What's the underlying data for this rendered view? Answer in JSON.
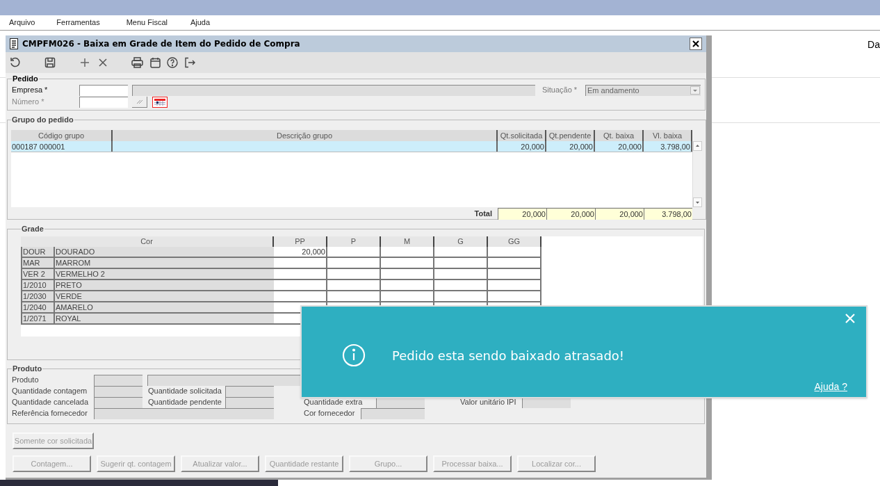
{
  "menu": [
    {
      "label": "Arquivo"
    },
    {
      "label": "Ferramentas"
    },
    {
      "label": "Menu Fiscal"
    },
    {
      "label": "Ajuda"
    }
  ],
  "background_text": "Da",
  "window": {
    "title": "CMPFM026 - Baixa em Grade de Item do Pedido de Compra"
  },
  "pedido": {
    "legend": "Pedido",
    "fields": [
      {
        "label": "Empresa *",
        "disabled": false
      },
      {
        "label": "Número *",
        "disabled": true
      }
    ],
    "situacao": {
      "label": "Situação *",
      "value": "Em andamento",
      "disabled": true
    }
  },
  "grupo": {
    "legend": "Grupo do pedido",
    "columns": [
      "Código grupo",
      "Descrição grupo",
      "Qt.solicitada",
      "Qt.pendente",
      "Qt. baixa",
      "Vl. baixa"
    ],
    "rows": [
      {
        "code": "000187 000001",
        "values": [
          "20,000",
          "20,000",
          "20,000",
          "3.798,00"
        ],
        "selected": true
      }
    ],
    "total": {
      "label": "Total",
      "values": [
        "20,000",
        "20,000",
        "20,000",
        "3.798,00"
      ]
    }
  },
  "grade": {
    "legend": "Grade",
    "columns": [
      "Cor",
      "PP",
      "P",
      "M",
      "G",
      "GG"
    ],
    "rows": [
      {
        "code": "DOUR",
        "name": "DOURADO",
        "pp": "20,000"
      },
      {
        "code": "MAR",
        "name": "MARROM"
      },
      {
        "code": "VER 2",
        "name": "VERMELHO 2"
      },
      {
        "code": "1/2010",
        "name": "PRETO"
      },
      {
        "code": "1/2030",
        "name": "VERDE"
      },
      {
        "code": "1/2040",
        "name": "AMARELO"
      },
      {
        "code": "1/2071",
        "name": "ROYAL"
      }
    ]
  },
  "produto": {
    "legend": "Produto",
    "labels": [
      "Produto",
      "Quantidade contagem",
      "Quantidade cancelada",
      "Referência fornecedor",
      "Quantidade solicitada",
      "Quantidade pendente",
      "Quantidade extra",
      "Valor unitário IPI",
      "Cor fornecedor"
    ]
  },
  "buttons": [
    {
      "label": "Somente cor solicitada",
      "disabled": true
    },
    {
      "label": "Contagem...",
      "disabled": true
    },
    {
      "label": "Sugerir qt. contagem",
      "disabled": true
    },
    {
      "label": "Atualizar valor...",
      "disabled": true
    },
    {
      "label": "Quantidade restante",
      "disabled": true
    },
    {
      "label": "Grupo...",
      "disabled": true
    },
    {
      "label": "Processar baixa...",
      "disabled": true
    },
    {
      "label": "Localizar cor...",
      "disabled": true
    }
  ],
  "toast": {
    "message": "Pedido esta sendo baixado atrasado!",
    "link": "Ajuda ?"
  }
}
